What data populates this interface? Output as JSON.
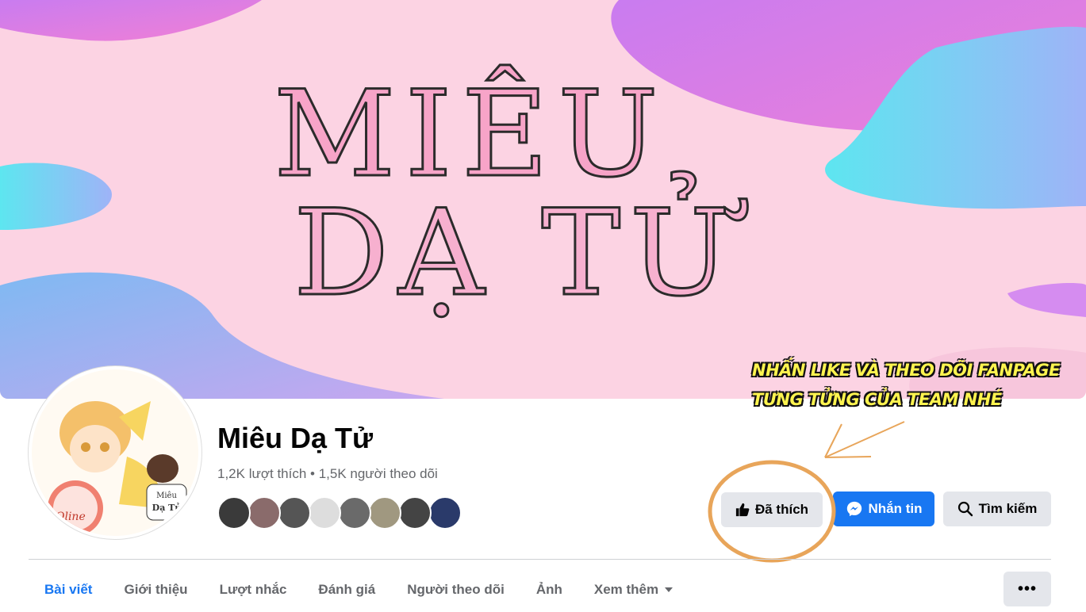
{
  "cover": {
    "title_line1": "MIÊU",
    "title_line2": "DẠ TỬ",
    "note_line1": "NHẤN LIKE VÀ THEO DÕI FANPAGE",
    "note_line2": "TƯNG TỬNG CỦA TEAM NHÉ"
  },
  "avatar": {
    "logo_line1": "Miêu",
    "logo_line2": "Dạ Tử",
    "ball_text": "Oline"
  },
  "page": {
    "name": "Miêu Dạ Tử",
    "stats": "1,2K lượt thích • 1,5K người theo dõi"
  },
  "friends": [
    "#3a3a3a",
    "#8a6b6b",
    "#555555",
    "#dddddd",
    "#6a6a6a",
    "#a09880",
    "#444444",
    "#2a3a6a"
  ],
  "actions": {
    "like_label": "Đã thích",
    "message_label": "Nhắn tin",
    "search_label": "Tìm kiếm"
  },
  "tabs": [
    {
      "label": "Bài viết",
      "active": true
    },
    {
      "label": "Giới thiệu"
    },
    {
      "label": "Lượt nhắc"
    },
    {
      "label": "Đánh giá"
    },
    {
      "label": "Người theo dõi"
    },
    {
      "label": "Ảnh"
    },
    {
      "label": "Xem thêm"
    }
  ],
  "more_button": "•••",
  "colors": {
    "accent": "#1877f2",
    "annotation": "#e8a55a",
    "note_text": "#fff44f"
  }
}
